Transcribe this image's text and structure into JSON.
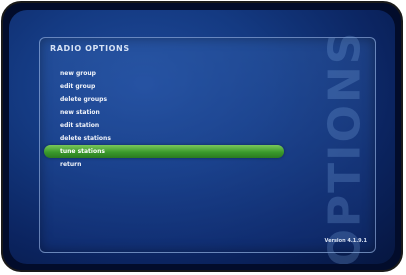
{
  "header": {
    "title": "RADIO OPTIONS"
  },
  "menu": {
    "items": [
      {
        "label": "new group",
        "selected": false
      },
      {
        "label": "edit group",
        "selected": false
      },
      {
        "label": "delete groups",
        "selected": false
      },
      {
        "label": "new station",
        "selected": false
      },
      {
        "label": "edit station",
        "selected": false
      },
      {
        "label": "delete stations",
        "selected": false
      },
      {
        "label": "tune stations",
        "selected": true
      },
      {
        "label": "return",
        "selected": false
      }
    ]
  },
  "watermark": {
    "text": "OPTIONS"
  },
  "footer": {
    "version": "Version 4.1.9.1"
  },
  "colors": {
    "background": "#143a82",
    "selection": "#3a9a2c",
    "text": "#f2f5fb"
  }
}
